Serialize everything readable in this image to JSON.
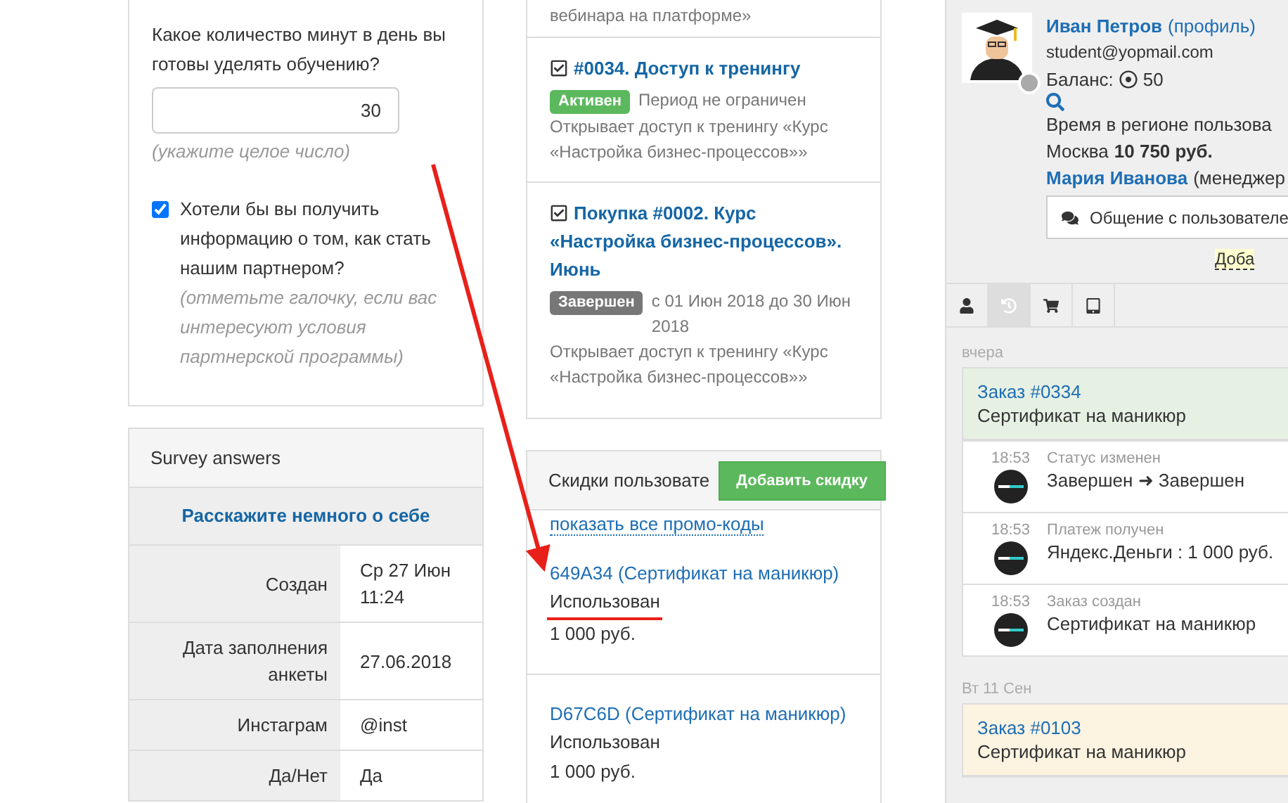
{
  "survey_form": {
    "question": "Какое количество минут в день вы готовы уделять обучению?",
    "answer": "30",
    "hint": "(укажите целое число)",
    "partner_checkbox": {
      "label": "Хотели бы вы получить информацию о том, как стать нашим партнером?",
      "hint": "(отметьте галочку, если вас интересуют условия партнерской программы)",
      "checked": true
    }
  },
  "survey_answers": {
    "title": "Survey answers",
    "section": "Расскажите немного о себе",
    "rows": [
      {
        "label": "Создан",
        "value": "Ср 27 Июн 11:24"
      },
      {
        "label": "Дата заполнения анкеты",
        "value": "27.06.2018"
      },
      {
        "label": "Инстаграм",
        "value": "@inst"
      },
      {
        "label": "Да/Нет",
        "value": "Да"
      }
    ]
  },
  "purchases": {
    "cut_text": "вебинара на платформе»",
    "items": [
      {
        "title": "#0034. Доступ к тренингу",
        "status": "Активен",
        "color": "#5cb85c",
        "period": "Период не ограничен",
        "description": "Открывает доступ к тренингу «Курс «Настройка бизнес-процессов»»"
      },
      {
        "title": "Покупка #0002. Курс «Настройка бизнес-процессов». Июнь",
        "status": "Завершен",
        "color": "#777777",
        "period": "с 01 Июн 2018 до 30 Июн 2018",
        "description": "Открывает доступ к тренингу «Курс «Настройка бизнес-процессов»»"
      }
    ]
  },
  "discounts": {
    "title": "Скидки пользовате",
    "add_button": "Добавить скидку",
    "show_all_link": "показать все промо-коды",
    "items": [
      {
        "code": "649A34",
        "name": "(Сертификат на маникюр)",
        "status": "Использован",
        "amount": "1 000 руб.",
        "highlighted": true
      },
      {
        "code": "D67C6D",
        "name": "(Сертификат на маникюр)",
        "status": "Использован",
        "amount": "1 000 руб.",
        "highlighted": false
      }
    ]
  },
  "profile": {
    "name": "Иван Петров",
    "profile_link": "(профиль)",
    "email": "student@yopmail.com",
    "balance_label": "Баланс:",
    "balance": "50",
    "online": false,
    "region_time": "Время в регионе пользова",
    "city": "Москва",
    "total": "10 750 руб.",
    "manager": "Мария Иванова",
    "manager_role": "(менеджер",
    "chat_button": "Общение с пользователе",
    "add_link": "Доба"
  },
  "tabs": [
    {
      "kind": "user",
      "selected": false
    },
    {
      "kind": "history",
      "selected": true
    },
    {
      "kind": "cart",
      "selected": false
    },
    {
      "kind": "tablet",
      "selected": false
    }
  ],
  "timeline": [
    {
      "date": "вчера",
      "order": "Заказ #0334",
      "product": "Сертификат на маникюр",
      "color": "#e6f0e3",
      "events": [
        {
          "time": "18:53",
          "label": "Статус изменен",
          "text": "Завершен ➜ Завершен"
        },
        {
          "time": "18:53",
          "label": "Платеж получен",
          "text": "Яндекс.Деньги : 1 000 руб."
        },
        {
          "time": "18:53",
          "label": "Заказ создан",
          "text": "Сертификат на маникюр"
        }
      ]
    },
    {
      "date": "Вт 11 Сен",
      "order": "Заказ #0103",
      "product": "Сертификат на маникюр",
      "color": "#fcf3e1"
    }
  ]
}
